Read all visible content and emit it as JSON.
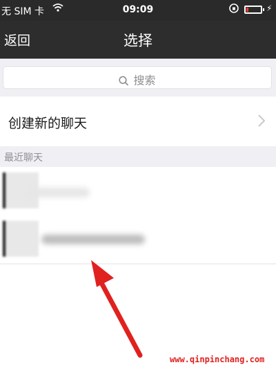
{
  "status_bar": {
    "carrier": "无 SIM 卡",
    "time": "09:09",
    "battery_color": "#ff3b30"
  },
  "nav": {
    "back_label": "返回",
    "title": "选择"
  },
  "search": {
    "placeholder": "搜索"
  },
  "new_chat": {
    "label": "创建新的聊天"
  },
  "recent": {
    "header": "最近聊天"
  },
  "annotation": {
    "arrow_color": "#e0211f"
  },
  "watermark": "www.qinpinchang.com"
}
